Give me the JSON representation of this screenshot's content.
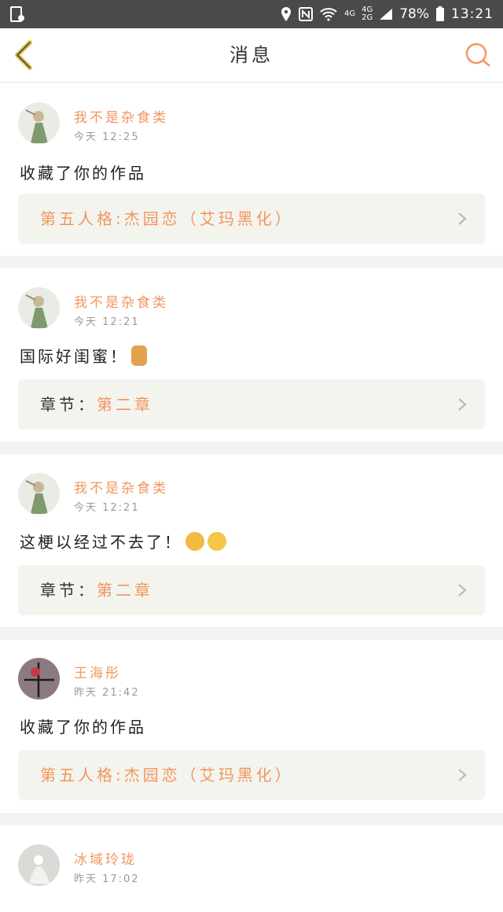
{
  "status_bar": {
    "net1": "4G",
    "net2_top": "4G",
    "net2_bottom": "2G",
    "battery": "78%",
    "time": "13:21",
    "icons": [
      "sim-icon",
      "location-icon",
      "nfc-icon",
      "wifi-icon",
      "signal-icon",
      "battery-icon"
    ]
  },
  "header": {
    "title": "消息"
  },
  "colors": {
    "accent": "#f2955f",
    "box_bg": "#f4f4ee"
  },
  "messages": [
    {
      "user": "我不是杂食类",
      "time": "今天 12:25",
      "text": "收藏了你的作品",
      "box_text": "第五人格:杰园恋（艾玛黑化）"
    },
    {
      "user": "我不是杂食类",
      "time": "今天 12:21",
      "text": "国际好闺蜜！",
      "emoji": "thumbs-up",
      "box_label": "章节：",
      "box_value": "第二章"
    },
    {
      "user": "我不是杂食类",
      "time": "今天 12:21",
      "text": "这梗以经过不去了！",
      "emoji": "tired-face, relieved-face",
      "box_label": "章节：",
      "box_value": "第二章"
    },
    {
      "user": "王海彤",
      "time": "昨天 21:42",
      "text": "收藏了你的作品",
      "box_text": "第五人格:杰园恋（艾玛黑化）"
    },
    {
      "user": "冰域玲珑",
      "time": "昨天 17:02"
    }
  ]
}
